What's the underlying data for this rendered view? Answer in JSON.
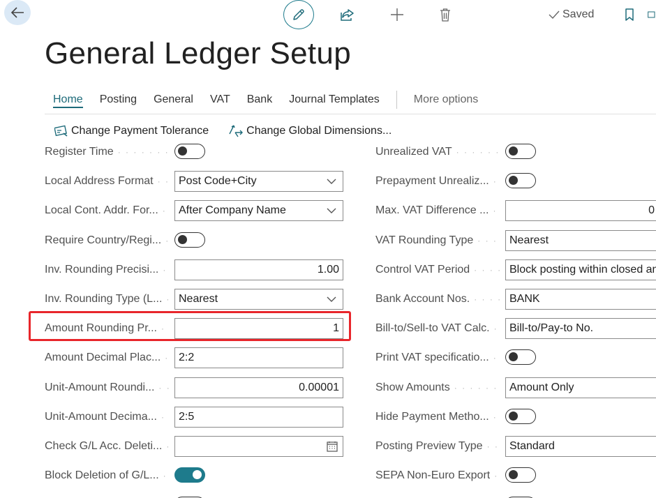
{
  "header": {
    "title": "General Ledger Setup",
    "saved_label": "Saved"
  },
  "tabs": [
    {
      "label": "Home",
      "active": true
    },
    {
      "label": "Posting"
    },
    {
      "label": "General"
    },
    {
      "label": "VAT"
    },
    {
      "label": "Bank"
    },
    {
      "label": "Journal Templates"
    }
  ],
  "more_options": "More options",
  "actions": {
    "change_payment_tolerance": "Change Payment Tolerance",
    "change_global_dimensions": "Change Global Dimensions..."
  },
  "left_fields": [
    {
      "label": "Register Time",
      "type": "toggle",
      "on": false
    },
    {
      "label": "Local Address Format",
      "type": "select",
      "value": "Post Code+City"
    },
    {
      "label": "Local Cont. Addr. For...",
      "type": "select",
      "value": "After Company Name"
    },
    {
      "label": "Require Country/Regi...",
      "type": "toggle",
      "on": false
    },
    {
      "label": "Inv. Rounding Precisi...",
      "type": "number",
      "value": "1.00"
    },
    {
      "label": "Inv. Rounding Type (L...",
      "type": "select",
      "value": "Nearest"
    },
    {
      "label": "Amount Rounding Pr...",
      "type": "number",
      "value": "1"
    },
    {
      "label": "Amount Decimal Plac...",
      "type": "text",
      "value": "2:2"
    },
    {
      "label": "Unit-Amount Roundi...",
      "type": "number",
      "value": "0.00001"
    },
    {
      "label": "Unit-Amount Decima...",
      "type": "text",
      "value": "2:5"
    },
    {
      "label": "Check G/L Acc. Deleti...",
      "type": "date",
      "value": ""
    },
    {
      "label": "Block Deletion of G/L...",
      "type": "toggle",
      "on": true
    }
  ],
  "right_fields": [
    {
      "label": "Unrealized VAT",
      "type": "toggle",
      "on": false
    },
    {
      "label": "Prepayment Unrealiz...",
      "type": "toggle",
      "on": false
    },
    {
      "label": "Max. VAT Difference ...",
      "type": "number",
      "value": "0"
    },
    {
      "label": "VAT Rounding Type",
      "type": "text",
      "value": "Nearest"
    },
    {
      "label": "Control VAT Period",
      "type": "text",
      "value": "Block posting within closed an"
    },
    {
      "label": "Bank Account Nos.",
      "type": "text",
      "value": "BANK"
    },
    {
      "label": "Bill-to/Sell-to VAT Calc.",
      "type": "text",
      "value": "Bill-to/Pay-to No."
    },
    {
      "label": "Print VAT specificatio...",
      "type": "toggle",
      "on": false
    },
    {
      "label": "Show Amounts",
      "type": "text",
      "value": "Amount Only"
    },
    {
      "label": "Hide Payment Metho...",
      "type": "toggle",
      "on": false
    },
    {
      "label": "Posting Preview Type",
      "type": "text",
      "value": "Standard"
    },
    {
      "label": "SEPA Non-Euro Export",
      "type": "toggle",
      "on": false
    }
  ],
  "colors": {
    "accent": "#1e7b8c",
    "highlight": "#e8262b"
  }
}
